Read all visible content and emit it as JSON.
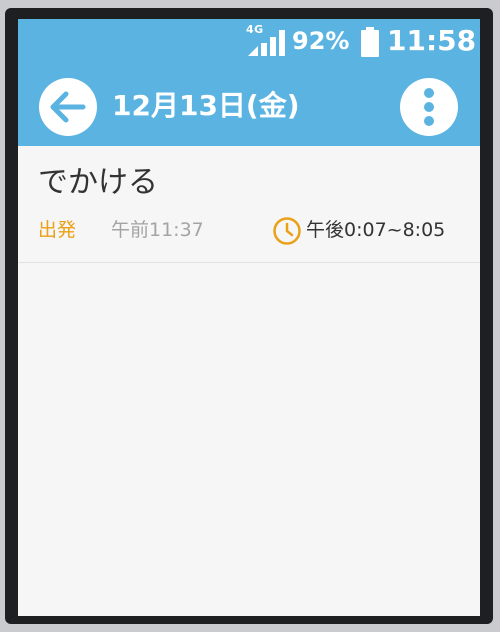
{
  "status_bar": {
    "network": "4G",
    "battery": "92%",
    "time": "11:58"
  },
  "header": {
    "title": "12月13日(金)"
  },
  "events": [
    {
      "title": "でかける",
      "type": "出発",
      "created": "午前11:37",
      "time_range": "午後0:07~8:05"
    }
  ],
  "icons": {
    "back": "arrow-left-icon",
    "menu": "more-vertical-icon",
    "signal": "signal-icon",
    "battery": "battery-icon",
    "clock": "clock-icon"
  },
  "colors": {
    "header": "#5ab3e0",
    "accent": "#eba117",
    "background": "#f6f6f7"
  }
}
